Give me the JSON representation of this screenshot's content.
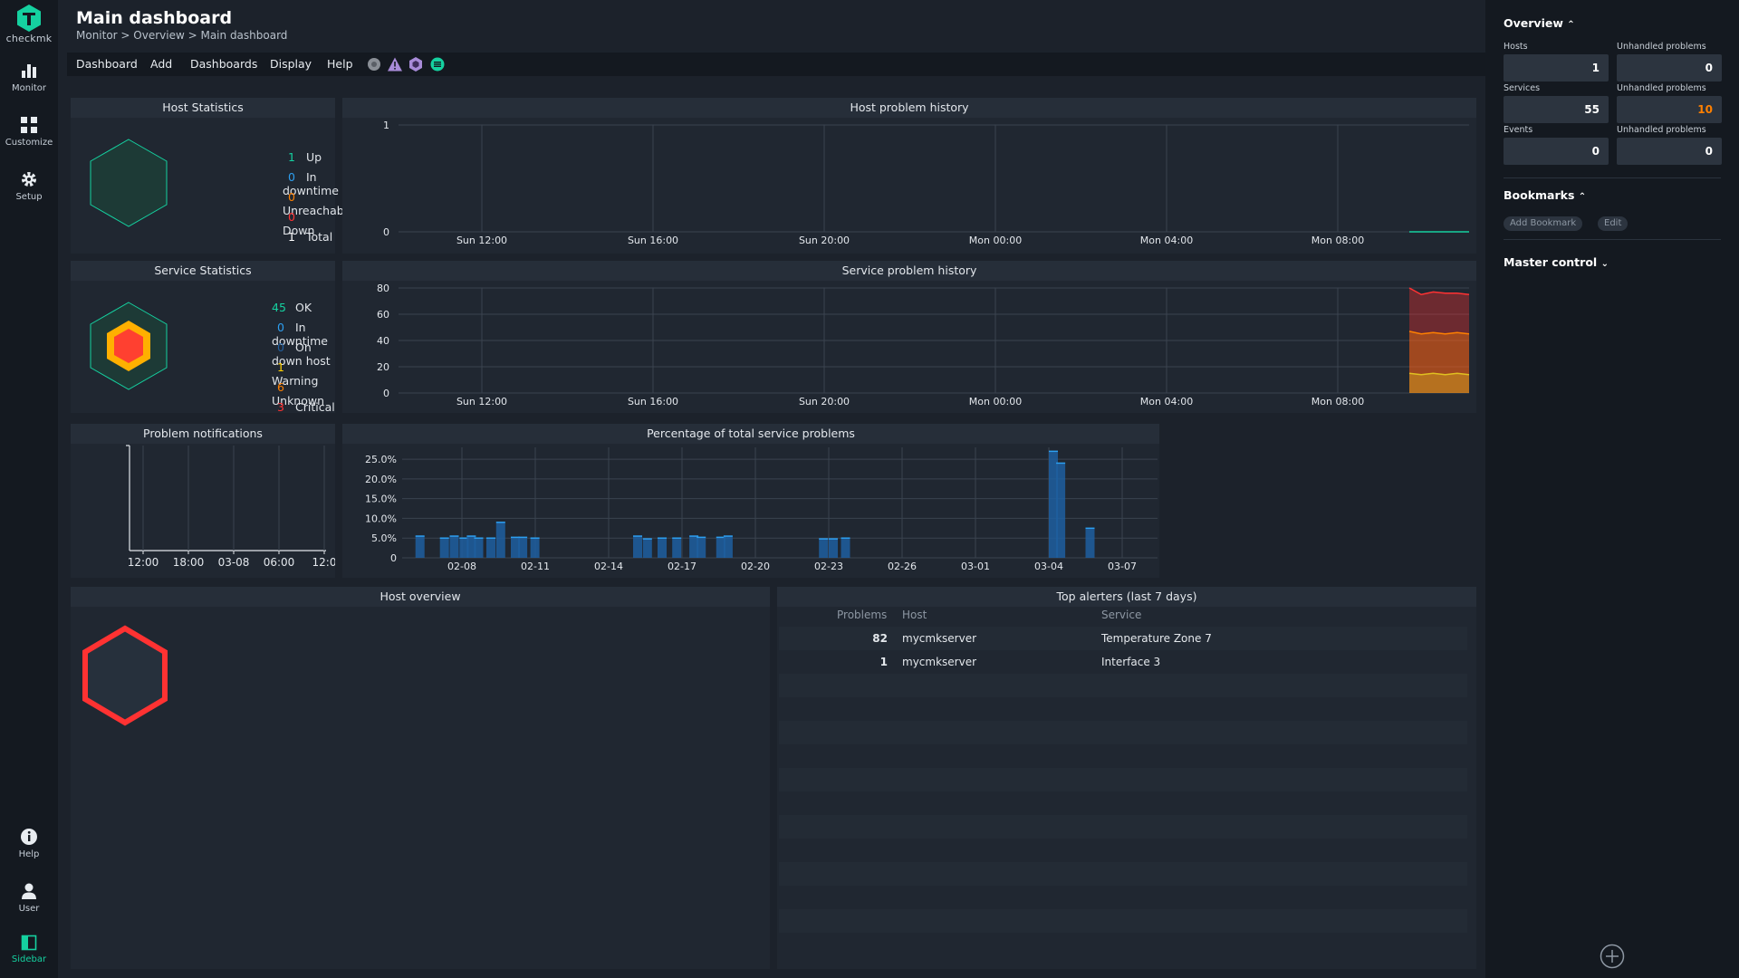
{
  "app": {
    "logo_text": "checkmk"
  },
  "leftnav": {
    "items": [
      {
        "label": "Monitor",
        "icon": "bar-chart-icon"
      },
      {
        "label": "Customize",
        "icon": "grid-icon"
      },
      {
        "label": "Setup",
        "icon": "gear-icon"
      },
      {
        "label": "Help",
        "icon": "info-icon"
      },
      {
        "label": "User",
        "icon": "user-icon"
      },
      {
        "label": "Sidebar",
        "icon": "sidebar-icon"
      }
    ]
  },
  "header": {
    "title": "Main dashboard",
    "breadcrumb": "Monitor > Overview > Main dashboard"
  },
  "menubar": {
    "items": [
      "Dashboard",
      "Add",
      "Dashboards",
      "Display",
      "Help"
    ],
    "icons": [
      "globe-icon",
      "warning-icon",
      "hexagon-icon",
      "menu-circle-icon"
    ]
  },
  "host_statistics": {
    "title": "Host Statistics",
    "rows": [
      {
        "count": "1",
        "label": "Up",
        "color": "#15d1a0"
      },
      {
        "count": "0",
        "label": "In downtime",
        "color": "#2d9ff0"
      },
      {
        "count": "0",
        "label": "Unreachable",
        "color": "#ff8000"
      },
      {
        "count": "0",
        "label": "Down",
        "color": "#ff3232"
      },
      {
        "count": "1",
        "label": "Total",
        "color": "#ffffff"
      }
    ]
  },
  "service_statistics": {
    "title": "Service Statistics",
    "rows": [
      {
        "count": "45",
        "label": "OK",
        "color": "#15d1a0"
      },
      {
        "count": "0",
        "label": "In downtime",
        "color": "#2d9ff0"
      },
      {
        "count": "0",
        "label": "On down host",
        "color": "#1f5fa0"
      },
      {
        "count": "1",
        "label": "Warning",
        "color": "#ffd000"
      },
      {
        "count": "6",
        "label": "Unknown",
        "color": "#ff8000"
      },
      {
        "count": "3",
        "label": "Critical",
        "color": "#ff3232"
      }
    ]
  },
  "host_problem_history": {
    "title": "Host problem history",
    "chart_data": {
      "type": "line",
      "x_ticks": [
        "Sun 12:00",
        "Sun 16:00",
        "Sun 20:00",
        "Mon 00:00",
        "Mon 04:00",
        "Mon 08:00"
      ],
      "ylim": [
        0,
        1
      ],
      "y_ticks": [
        "0",
        "1"
      ],
      "series": [
        {
          "values": [
            0,
            0,
            0,
            0,
            0,
            0
          ]
        }
      ]
    }
  },
  "service_problem_history": {
    "title": "Service problem history",
    "chart_data": {
      "type": "area",
      "x_ticks": [
        "Sun 12:00",
        "Sun 16:00",
        "Sun 20:00",
        "Mon 00:00",
        "Mon 04:00",
        "Mon 08:00"
      ],
      "ylim": [
        0,
        80
      ],
      "y_ticks": [
        "0",
        "20",
        "40",
        "60",
        "80"
      ],
      "series": [
        {
          "color": "#e0c020",
          "values": [
            15,
            14,
            15,
            14,
            15,
            14
          ]
        },
        {
          "color": "#ff8000",
          "values": [
            47,
            45,
            46,
            45,
            46,
            45
          ]
        },
        {
          "color": "#ff3232",
          "values": [
            80,
            75,
            77,
            76,
            76,
            75
          ]
        }
      ]
    }
  },
  "problem_notifications": {
    "title": "Problem notifications",
    "chart_data": {
      "type": "bar",
      "x_ticks": [
        "12:00",
        "18:00",
        "03-08",
        "06:00",
        "12:0"
      ],
      "values": []
    }
  },
  "percentage_problems": {
    "title": "Percentage of total service problems",
    "chart_data": {
      "type": "bar",
      "x_ticks": [
        "02-08",
        "02-11",
        "02-14",
        "02-17",
        "02-20",
        "02-23",
        "02-26",
        "03-01",
        "03-04",
        "03-07"
      ],
      "y_ticks": [
        "0",
        "5.0%",
        "10.0%",
        "15.0%",
        "20.0%",
        "25.0%"
      ],
      "ylim": [
        0,
        28
      ],
      "bars": [
        {
          "x": 6.1,
          "y": 5.5
        },
        {
          "x": 7.1,
          "y": 5.0
        },
        {
          "x": 7.5,
          "y": 5.5
        },
        {
          "x": 7.9,
          "y": 5.0
        },
        {
          "x": 8.2,
          "y": 5.5
        },
        {
          "x": 8.5,
          "y": 5.0
        },
        {
          "x": 9.0,
          "y": 5.0
        },
        {
          "x": 9.4,
          "y": 9.0
        },
        {
          "x": 10.0,
          "y": 5.2
        },
        {
          "x": 10.3,
          "y": 5.2
        },
        {
          "x": 10.8,
          "y": 5.0
        },
        {
          "x": 15.0,
          "y": 5.5
        },
        {
          "x": 15.4,
          "y": 4.8
        },
        {
          "x": 16.0,
          "y": 5.0
        },
        {
          "x": 16.6,
          "y": 5.0
        },
        {
          "x": 17.3,
          "y": 5.5
        },
        {
          "x": 17.6,
          "y": 5.2
        },
        {
          "x": 18.4,
          "y": 5.2
        },
        {
          "x": 18.7,
          "y": 5.5
        },
        {
          "x": 22.6,
          "y": 4.8
        },
        {
          "x": 23.0,
          "y": 4.8
        },
        {
          "x": 23.5,
          "y": 5.0
        },
        {
          "x": 32.0,
          "y": 27.0
        },
        {
          "x": 32.3,
          "y": 24.0
        },
        {
          "x": 33.5,
          "y": 7.5
        }
      ]
    }
  },
  "host_overview": {
    "title": "Host overview"
  },
  "top_alerters": {
    "title": "Top alerters (last 7 days)",
    "columns": [
      "Problems",
      "Host",
      "Service"
    ],
    "rows": [
      {
        "problems": "82",
        "host": "mycmkserver",
        "service": "Temperature Zone 7"
      },
      {
        "problems": "1",
        "host": "mycmkserver",
        "service": "Interface 3"
      }
    ]
  },
  "sidebar": {
    "overview": {
      "title": "Overview",
      "rows": [
        {
          "label": "Hosts",
          "value": "1",
          "unhandled_label": "Unhandled problems",
          "unhandled": "0",
          "unhandled_color": "#ffffff"
        },
        {
          "label": "Services",
          "value": "55",
          "unhandled_label": "Unhandled problems",
          "unhandled": "10",
          "unhandled_color": "#ff8000"
        },
        {
          "label": "Events",
          "value": "0",
          "unhandled_label": "Unhandled problems",
          "unhandled": "0",
          "unhandled_color": "#ffffff"
        }
      ]
    },
    "bookmarks": {
      "title": "Bookmarks",
      "add_label": "Add Bookmark",
      "edit_label": "Edit"
    },
    "master_control": {
      "title": "Master control"
    }
  },
  "colors": {
    "accent": "#15d1a0",
    "critical": "#ff3232",
    "warning": "#ffd000",
    "unknown": "#ff8000"
  }
}
